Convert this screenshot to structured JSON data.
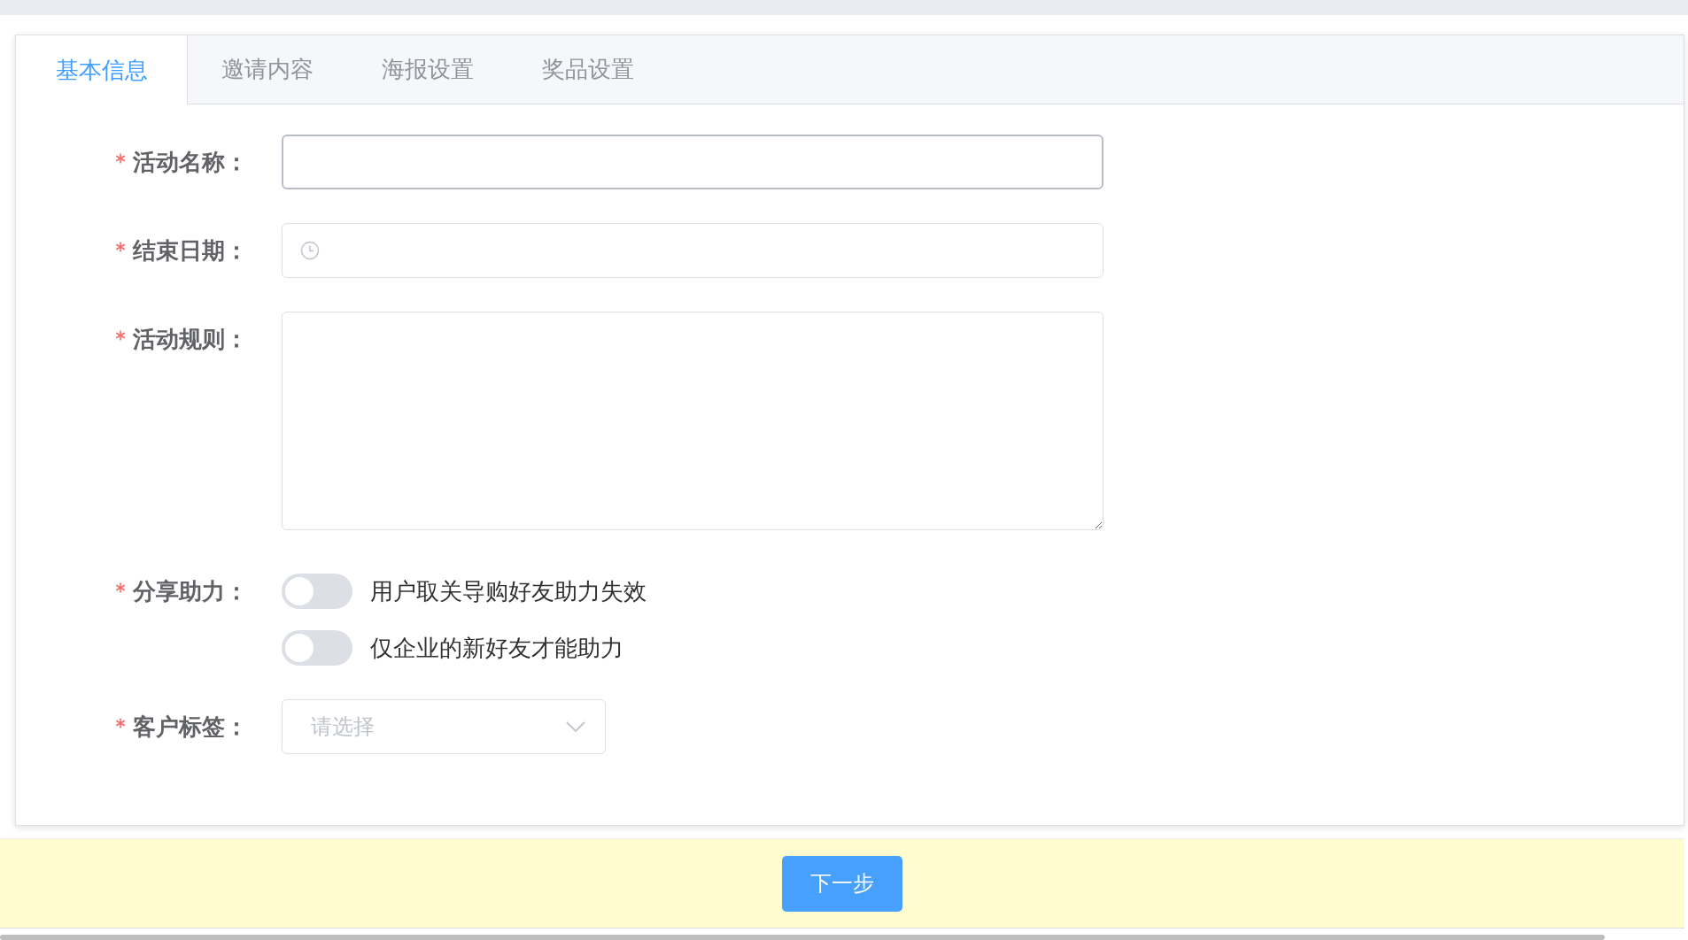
{
  "tabs": [
    {
      "label": "基本信息",
      "selected": true
    },
    {
      "label": "邀请内容",
      "selected": false
    },
    {
      "label": "海报设置",
      "selected": false
    },
    {
      "label": "奖品设置",
      "selected": false
    }
  ],
  "form": [
    {
      "kind": "input",
      "label": "活动名称：",
      "required": true
    },
    {
      "kind": "date",
      "label": "结束日期：",
      "required": true
    },
    {
      "kind": "textarea",
      "label": "活动规则：",
      "required": true
    },
    {
      "kind": "switches",
      "label": "分享助力：",
      "required": true,
      "switches": [
        {
          "text": "用户取关导购好友助力失效",
          "on": false
        },
        {
          "text": "仅企业的新好友才能助力",
          "on": false
        }
      ]
    },
    {
      "kind": "select",
      "label": "客户标签：",
      "required": true,
      "placeholder": "请选择"
    }
  ],
  "footer": {
    "button": "下一步"
  }
}
